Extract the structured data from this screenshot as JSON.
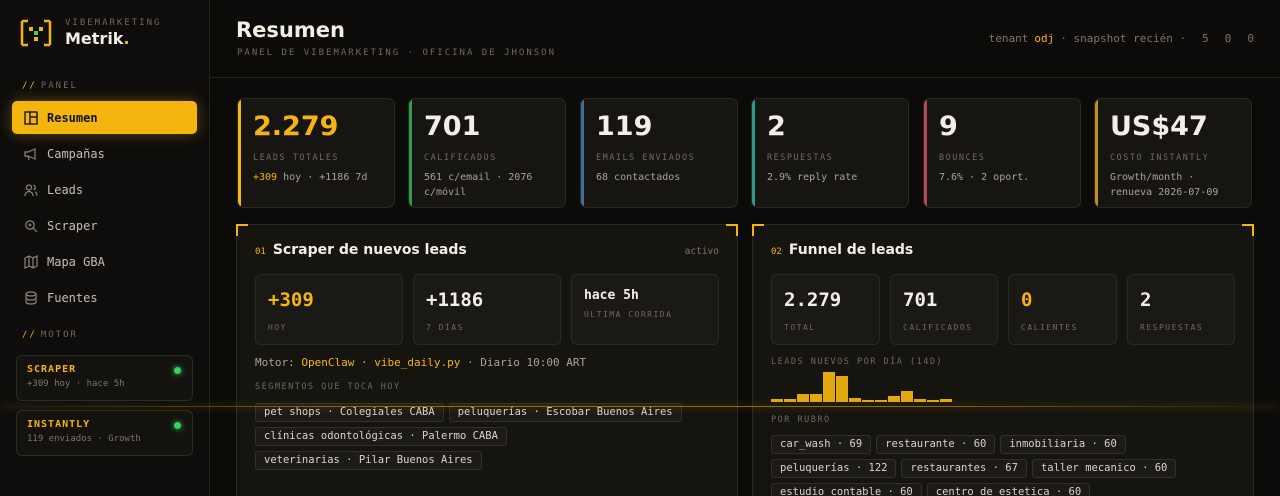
{
  "brand": {
    "sub": "VIBEMARKETING",
    "name": "Metrik",
    "dot": "."
  },
  "sidebar": {
    "panel_prefix": "//",
    "panel_label": "PANEL",
    "items": [
      {
        "label": "Resumen",
        "icon": "layout-icon",
        "active": true
      },
      {
        "label": "Campañas",
        "icon": "megaphone-icon"
      },
      {
        "label": "Leads",
        "icon": "users-icon"
      },
      {
        "label": "Scraper",
        "icon": "search-icon"
      },
      {
        "label": "Mapa GBA",
        "icon": "map-icon"
      },
      {
        "label": "Fuentes",
        "icon": "database-icon"
      }
    ],
    "motor_prefix": "//",
    "motor_label": "MOTOR",
    "motors": [
      {
        "title": "SCRAPER",
        "sub": "+309 hoy · hace 5h",
        "status_color": "#37d064"
      },
      {
        "title": "INSTANTLY",
        "sub": "119 enviados · Growth",
        "status_color": "#37d064"
      }
    ]
  },
  "header": {
    "title": "Resumen",
    "subtitle": "PANEL DE VIBEMARKETING · OFICINA DE JHONSON",
    "tenant_label": "tenant",
    "tenant_value": "odj",
    "snapshot": "· snapshot recién ·",
    "counters": [
      "5",
      "0",
      "0"
    ]
  },
  "kpis": [
    {
      "value": "2.279",
      "label": "LEADS TOTALES",
      "note_hl": "+309",
      "note": " hoy · +1186 7d",
      "color": "#f5b50f"
    },
    {
      "value": "701",
      "label": "CALIFICADOS",
      "note_hl": "",
      "note": "561 c/email · 2076 c/móvil",
      "color": "#2e9a4f"
    },
    {
      "value": "119",
      "label": "EMAILS ENVIADOS",
      "note_hl": "",
      "note": "68 contactados",
      "color": "#3f6e9e"
    },
    {
      "value": "2",
      "label": "RESPUESTAS",
      "note_hl": "",
      "note": "2.9% reply rate",
      "color": "#2f9b8e"
    },
    {
      "value": "9",
      "label": "BOUNCES",
      "note_hl": "",
      "note": "7.6% · 2 oport.",
      "color": "#b04a58"
    },
    {
      "value": "US$47",
      "label": "COSTO INSTANTLY",
      "note_hl": "",
      "note": "Growth/month · renueva 2026-07-09",
      "color": "#c48f10"
    }
  ],
  "scraper_panel": {
    "num": "01",
    "title": "Scraper de nuevos leads",
    "status": "activo",
    "stats": [
      {
        "value": "+309",
        "label": "HOY"
      },
      {
        "value": "+1186",
        "label": "7 DÍAS"
      },
      {
        "value": "hace 5h",
        "label": "ÚLTIMA CORRIDA"
      }
    ],
    "motor_prefix": "Motor:",
    "motor_name": "OpenClaw · vibe_daily.py",
    "motor_schedule": " · Diario 10:00 ART",
    "segments_label": "SEGMENTOS QUE TOCA HOY",
    "segments": [
      "pet shops · Colegiales CABA",
      "peluquerías · Escobar Buenos Aires",
      "clínicas odontológicas · Palermo CABA",
      "veterinarias · Pilar Buenos Aires"
    ]
  },
  "funnel_panel": {
    "num": "02",
    "title": "Funnel de leads",
    "stats": [
      {
        "value": "2.279",
        "label": "TOTAL"
      },
      {
        "value": "701",
        "label": "CALIFICADOS"
      },
      {
        "value": "0",
        "label": "CALIENTES"
      },
      {
        "value": "2",
        "label": "RESPUESTAS"
      }
    ],
    "daily_label": "LEADS NUEVOS POR DÍA (14D)",
    "daily_values": [
      20,
      20,
      55,
      55,
      200,
      170,
      25,
      15,
      15,
      40,
      70,
      20,
      15,
      20
    ],
    "rubro_label": "POR RUBRO",
    "rubros": [
      "car_wash · 69",
      "restaurante · 60",
      "inmobiliaria · 60",
      "peluquerías · 122",
      "restaurantes · 67",
      "taller mecanico · 60",
      "estudio contable · 60",
      "centro de estetica · 60"
    ]
  }
}
